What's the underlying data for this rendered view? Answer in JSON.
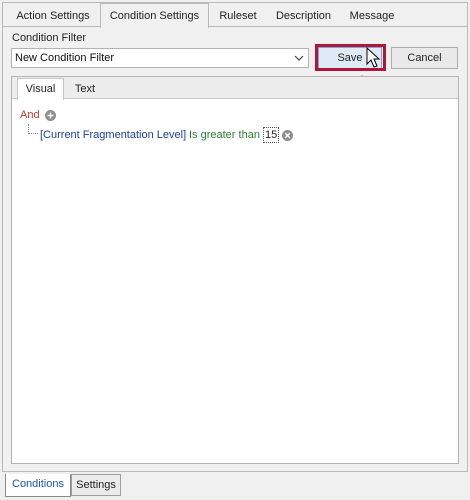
{
  "top_tabs": [
    {
      "label": "Action Settings",
      "active": false
    },
    {
      "label": "Condition Settings",
      "active": true
    },
    {
      "label": "Ruleset",
      "active": false
    },
    {
      "label": "Description",
      "active": false
    },
    {
      "label": "Message",
      "active": false
    }
  ],
  "condition_filter": {
    "label": "Condition Filter",
    "selected": "New Condition Filter"
  },
  "buttons": {
    "save": "Save",
    "cancel": "Cancel"
  },
  "editor": {
    "tabs": [
      {
        "label": "Visual",
        "active": true
      },
      {
        "label": "Text",
        "active": false
      }
    ],
    "group_operator": "And",
    "condition": {
      "field": "[Current Fragmentation Level]",
      "operator": "Is greater than",
      "value": "15"
    }
  },
  "bottom_tabs": [
    {
      "label": "Conditions",
      "active": true
    },
    {
      "label": "Settings",
      "active": false
    }
  ],
  "colors": {
    "highlight": "#b0163a",
    "group_operator": "#c0392b",
    "field": "#1a3fa0",
    "operator": "#2e7d32"
  },
  "icons": [
    "chevron-down-icon",
    "add-icon",
    "remove-icon",
    "mouse-cursor-icon",
    "arrow-up-icon"
  ]
}
